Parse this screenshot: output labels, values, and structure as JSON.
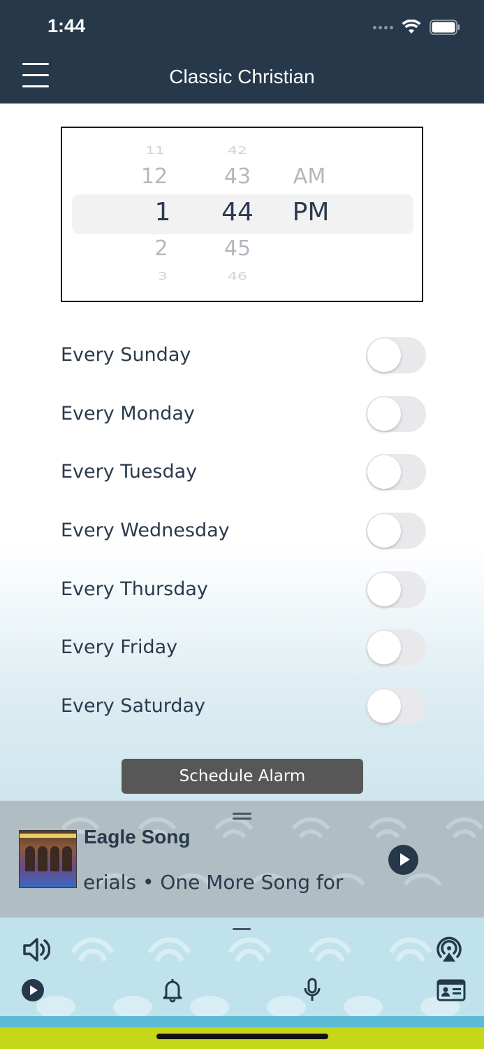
{
  "status_bar": {
    "time": "1:44"
  },
  "header": {
    "title": "Classic Christian"
  },
  "picker": {
    "hours": [
      "11",
      "12",
      "1",
      "2",
      "3"
    ],
    "minutes": [
      "42",
      "43",
      "44",
      "45",
      "46"
    ],
    "periods": [
      "AM",
      "PM"
    ]
  },
  "days": [
    {
      "label": "Every Sunday",
      "on": false
    },
    {
      "label": "Every Monday",
      "on": false
    },
    {
      "label": "Every Tuesday",
      "on": false
    },
    {
      "label": "Every Wednesday",
      "on": false
    },
    {
      "label": "Every Thursday",
      "on": false
    },
    {
      "label": "Every Friday",
      "on": false
    },
    {
      "label": "Every Saturday",
      "on": false
    }
  ],
  "schedule_button": "Schedule Alarm",
  "now_playing": {
    "title": "Eagle Song",
    "subtitle": "erials • One More Song for",
    "album_art_text": "ONE MORE SONG FOR YOU"
  },
  "bottom_bar": {
    "icons": [
      "volume-icon",
      "airplay-icon",
      "play-icon",
      "bell-icon",
      "microphone-icon",
      "contact-card-icon"
    ]
  },
  "colors": {
    "header_bg": "#26384a",
    "button_bg": "#575757",
    "player_bg": "#b0bec4",
    "footer_bg": "#bfe2ec",
    "stripe_blue": "#5bbad4",
    "stripe_green": "#c6d71a"
  }
}
